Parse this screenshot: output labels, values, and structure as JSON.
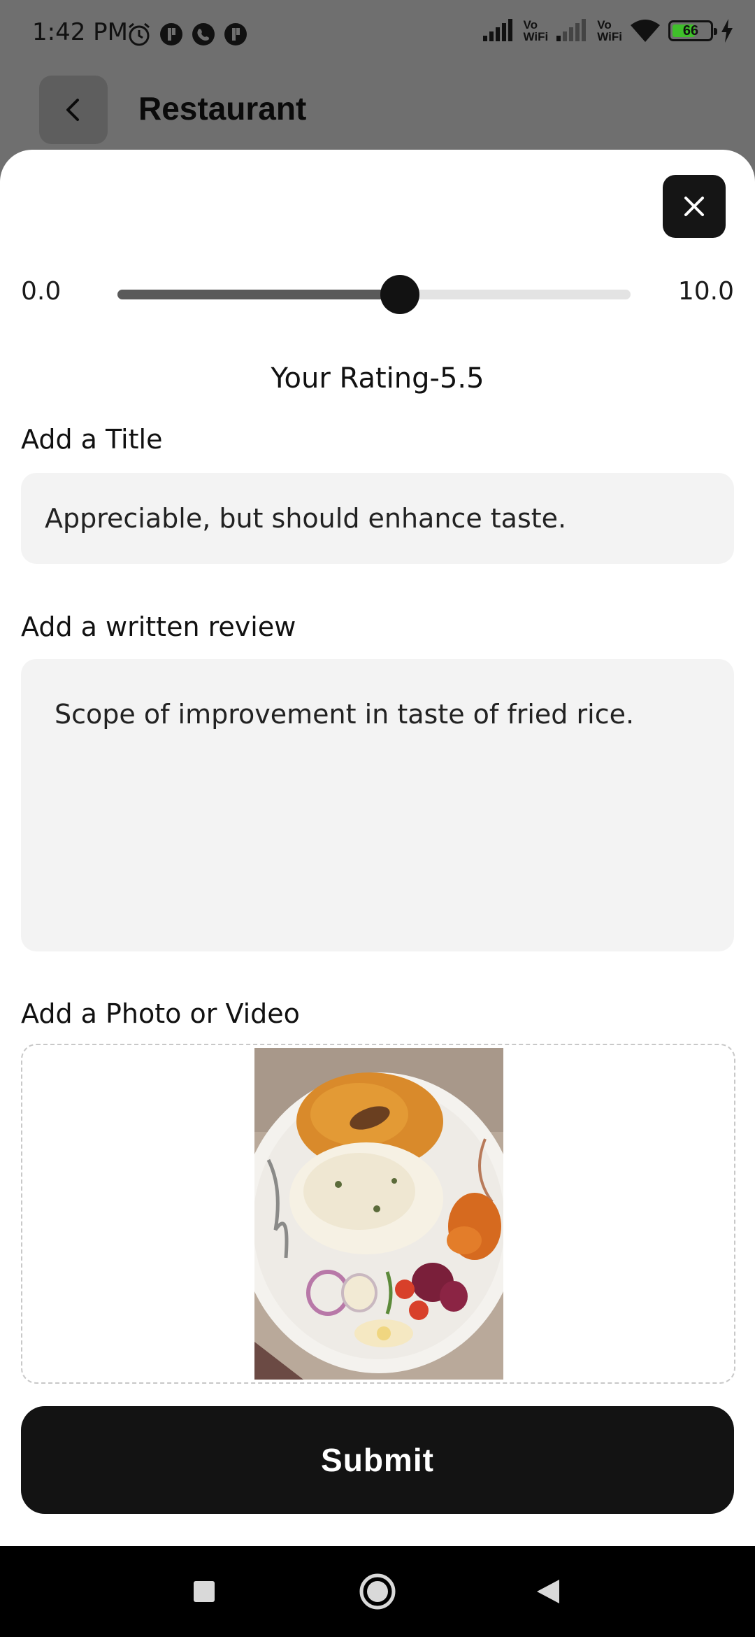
{
  "status_bar": {
    "time": "1:42 PM",
    "battery_level": 66,
    "battery_label": "66",
    "vowifi_label_top": "Vo",
    "vowifi_label_bottom": "WiFi",
    "icons": [
      "alarm-icon",
      "app-icon",
      "phone-app-icon",
      "app-icon",
      "signal-icon",
      "vowifi-icon",
      "signal-icon",
      "vowifi-icon",
      "wifi-icon",
      "battery-icon",
      "charging-icon"
    ]
  },
  "header": {
    "title": "Restaurant",
    "back_icon": "chevron-left-icon"
  },
  "sheet": {
    "close_icon": "close-icon",
    "slider": {
      "min_label": "0.0",
      "max_label": "10.0",
      "min": 0,
      "max": 10,
      "value": 5.5
    },
    "rating_label": "Your Rating-5.5",
    "title_field": {
      "label": "Add a Title",
      "value": "Appreciable, but should enhance taste."
    },
    "review_field": {
      "label": "Add a written review",
      "value": "Scope of improvement in taste of fried rice."
    },
    "photo_field": {
      "label": "Add a Photo or Video"
    },
    "submit_label": "Submit"
  },
  "nav_bar": {
    "icons": [
      "recent-apps-icon",
      "home-icon",
      "back-icon"
    ]
  },
  "colors": {
    "scrim": "#6f6f6f",
    "accent_dark": "#131313",
    "input_bg": "#f3f3f3",
    "battery_fill": "#3fbf2a"
  }
}
